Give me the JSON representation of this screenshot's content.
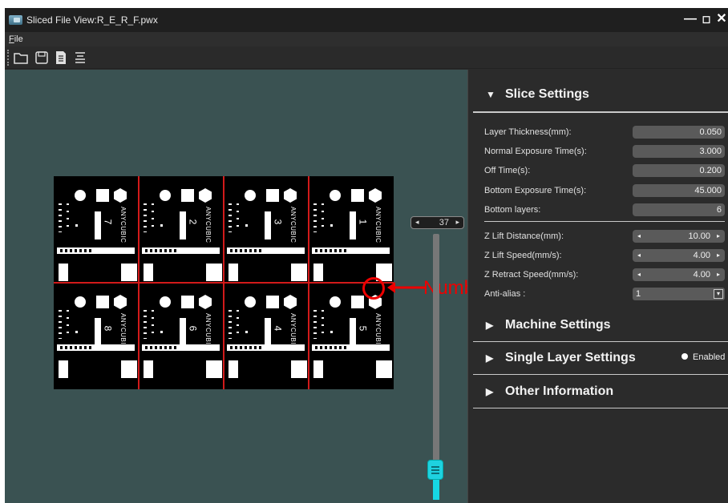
{
  "window": {
    "title": "Sliced File View:R_E_R_F.pwx",
    "minimize_glyph": "—",
    "maximize_glyph": "◻",
    "close_glyph": "✕"
  },
  "menu": {
    "file": "File"
  },
  "toolbar": {
    "icons": [
      "open-folder-icon",
      "save-icon",
      "document-icon",
      "list-icon"
    ]
  },
  "viewport": {
    "cells": [
      {
        "number": "1",
        "text": "ANYCUBIC"
      },
      {
        "number": "2",
        "text": "ANYCUBIC"
      },
      {
        "number": "3",
        "text": "ANYCUBIC"
      },
      {
        "number": "7",
        "text": "ANYCUBIC"
      },
      {
        "number": "8",
        "text": "ANYCUBIC"
      },
      {
        "number": "6",
        "text": "ANYCUBIC"
      },
      {
        "number": "4",
        "text": "ANYCUBIC"
      },
      {
        "number": "5",
        "text": "ANYCUBIC"
      }
    ],
    "annotation": {
      "label": "Number",
      "color": "#ee0000"
    },
    "layer": {
      "current": "37",
      "left_glyph": "◂",
      "right_glyph": "▸",
      "position_fraction": 0.88
    },
    "background": "#3a5252",
    "accent": "#16d7e4"
  },
  "panel": {
    "slice_settings": {
      "title": "Slice Settings",
      "rows": [
        {
          "label": "Layer Thickness(mm):",
          "value": "0.050"
        },
        {
          "label": "Normal Exposure Time(s):",
          "value": "3.000"
        },
        {
          "label": "Off Time(s):",
          "value": "0.200"
        },
        {
          "label": "Bottom Exposure Time(s):",
          "value": "45.000"
        },
        {
          "label": "Bottom layers:",
          "value": "6"
        }
      ],
      "spin_rows": [
        {
          "label": "Z Lift Distance(mm):",
          "value": "10.00"
        },
        {
          "label": "Z Lift Speed(mm/s):",
          "value": "4.00"
        },
        {
          "label": "Z Retract Speed(mm/s):",
          "value": "4.00"
        }
      ],
      "anti_alias": {
        "label": "Anti-alias :",
        "value": "1"
      }
    },
    "machine_settings": {
      "title": "Machine Settings"
    },
    "single_layer_settings": {
      "title": "Single Layer Settings",
      "status": "Enabled"
    },
    "other_information": {
      "title": "Other Information"
    }
  }
}
